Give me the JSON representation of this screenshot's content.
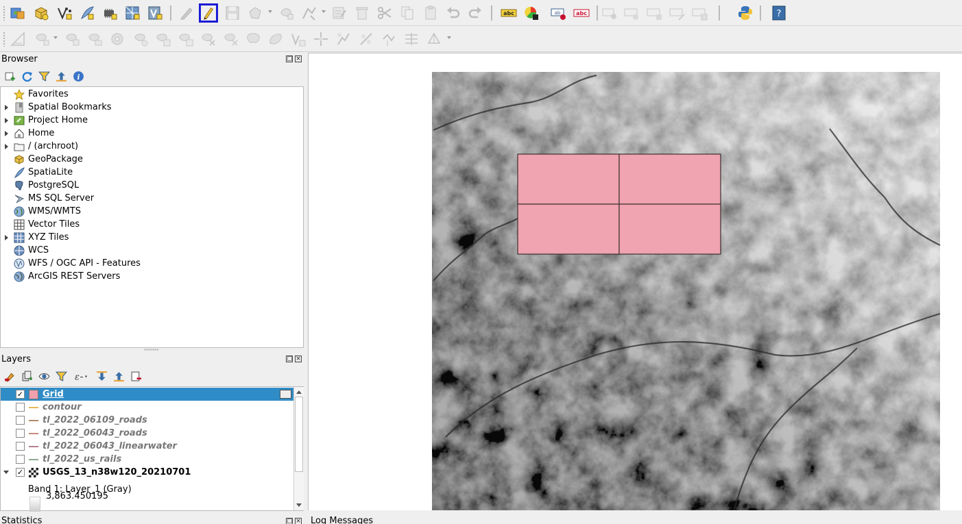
{
  "toolbar_main": {
    "buttons": [
      {
        "name": "open-data-source-manager-icon"
      },
      {
        "name": "new-geopackage-layer-icon"
      },
      {
        "name": "new-shapefile-layer-icon"
      },
      {
        "name": "new-spatialite-layer-icon"
      },
      {
        "name": "new-virtual-layer-icon"
      },
      {
        "name": "new-mesh-layer-icon"
      },
      {
        "name": "new-gps-layer-icon"
      },
      {
        "name": "current-edits-icon"
      },
      {
        "name": "toggle-editing-icon",
        "active": true
      },
      {
        "name": "save-edits-icon"
      },
      {
        "name": "digitize-polygon-icon"
      },
      {
        "name": "vertex-tool-icon"
      },
      {
        "name": "modify-attributes-icon"
      },
      {
        "name": "delete-selected-icon"
      },
      {
        "name": "cut-features-icon"
      },
      {
        "name": "copy-features-icon"
      },
      {
        "name": "paste-features-icon"
      },
      {
        "name": "undo-icon"
      },
      {
        "name": "redo-icon"
      },
      {
        "name": "layer-labeling-icon"
      },
      {
        "name": "layer-diagram-icon"
      },
      {
        "name": "highlight-pinned-labels-icon"
      },
      {
        "name": "pin-unpin-labels-icon"
      },
      {
        "name": "python-console-icon"
      },
      {
        "name": "help-icon"
      }
    ],
    "label_button_text": "abc",
    "help_text": "?"
  },
  "browser": {
    "title": "Browser",
    "items": [
      {
        "label": "Favorites",
        "icon": "star-icon",
        "expandable": false
      },
      {
        "label": "Spatial Bookmarks",
        "icon": "bookmark-icon",
        "expandable": true
      },
      {
        "label": "Project Home",
        "icon": "project-home-icon",
        "expandable": true
      },
      {
        "label": "Home",
        "icon": "home-icon",
        "expandable": true
      },
      {
        "label": "/ (archroot)",
        "icon": "folder-icon",
        "expandable": true
      },
      {
        "label": "GeoPackage",
        "icon": "geopackage-icon",
        "expandable": false
      },
      {
        "label": "SpatiaLite",
        "icon": "spatialite-icon",
        "expandable": false
      },
      {
        "label": "PostgreSQL",
        "icon": "postgresql-icon",
        "expandable": false
      },
      {
        "label": "MS SQL Server",
        "icon": "mssql-icon",
        "expandable": false
      },
      {
        "label": "WMS/WMTS",
        "icon": "globe-icon",
        "expandable": false
      },
      {
        "label": "Vector Tiles",
        "icon": "vector-tiles-icon",
        "expandable": false
      },
      {
        "label": "XYZ Tiles",
        "icon": "xyz-tiles-icon",
        "expandable": true
      },
      {
        "label": "WCS",
        "icon": "wcs-icon",
        "expandable": false
      },
      {
        "label": "WFS / OGC API - Features",
        "icon": "wfs-icon",
        "expandable": false
      },
      {
        "label": "ArcGIS REST Servers",
        "icon": "arcgis-icon",
        "expandable": false
      }
    ]
  },
  "layers": {
    "title": "Layers",
    "rows": [
      {
        "name": "Grid",
        "checked": true,
        "visible": true,
        "selected": true,
        "swatch": "#f0a0ae",
        "type": "polygon"
      },
      {
        "name": "contour",
        "checked": false,
        "visible": false,
        "swatch": "#e8b85a",
        "type": "line"
      },
      {
        "name": "tl_2022_06109_roads",
        "checked": false,
        "visible": false,
        "swatch": "#b08a6a",
        "type": "line"
      },
      {
        "name": "tl_2022_06043_roads",
        "checked": false,
        "visible": false,
        "swatch": "#c98a7a",
        "type": "line"
      },
      {
        "name": "tl_2022_06043_linearwater",
        "checked": false,
        "visible": false,
        "swatch": "#b47f95",
        "type": "line"
      },
      {
        "name": "tl_2022_us_rails",
        "checked": false,
        "visible": false,
        "swatch": "#8fa88e",
        "type": "line"
      },
      {
        "name": "USGS_13_n38w120_20210701",
        "checked": true,
        "visible": true,
        "swatch": "#333333",
        "type": "raster"
      }
    ],
    "legend_band": "Band 1: Layer_1 (Gray)",
    "legend_max": "3,863.450195",
    "check_mark": "✓"
  },
  "bottom_docks": {
    "statistics_title": "Statistics",
    "log_title": "Log Messages"
  },
  "map": {
    "grid_fill": "#f0a3b0",
    "grid_stroke": "#3b2f2f"
  }
}
